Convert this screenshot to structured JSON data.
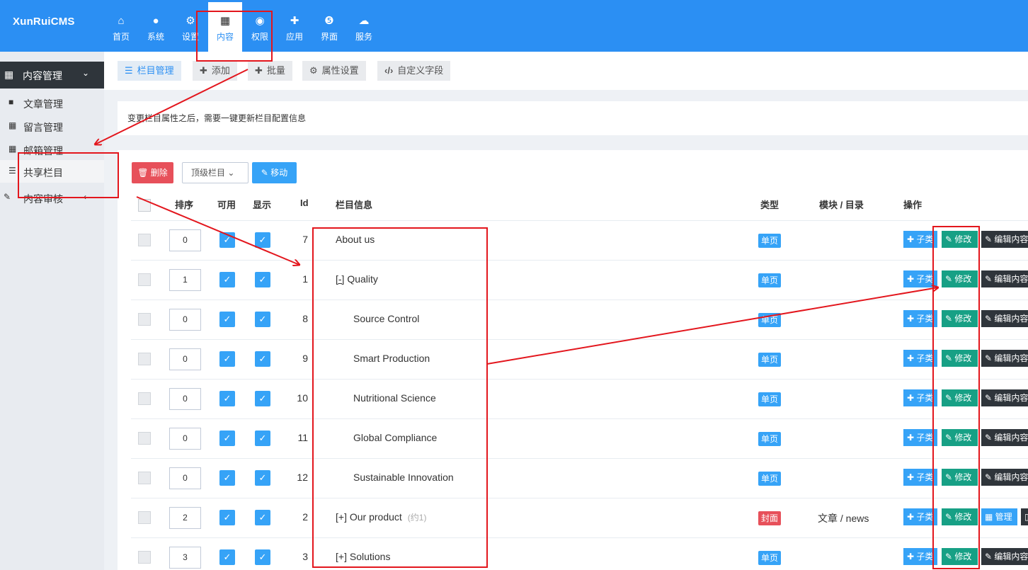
{
  "header": {
    "logo": "XunRuiCMS",
    "nav": [
      {
        "icon": "home-icon",
        "glyph": "⌂",
        "label": "首页"
      },
      {
        "icon": "globe-icon",
        "glyph": "●",
        "label": "系统"
      },
      {
        "icon": "gears-icon",
        "glyph": "⚙",
        "label": "设置"
      },
      {
        "icon": "grid-icon",
        "glyph": "▦",
        "label": "内容"
      },
      {
        "icon": "user-circle-icon",
        "glyph": "◉",
        "label": "权限"
      },
      {
        "icon": "puzzle-icon",
        "glyph": "✚",
        "label": "应用"
      },
      {
        "icon": "html5-icon",
        "glyph": "❺",
        "label": "界面"
      },
      {
        "icon": "cloud-icon",
        "glyph": "☁",
        "label": "服务"
      }
    ]
  },
  "sidebar": {
    "group": "内容管理",
    "items": [
      {
        "label": "文章管理"
      },
      {
        "label": "留言管理"
      },
      {
        "label": "邮箱管理"
      },
      {
        "label": "共享栏目"
      }
    ],
    "group2": "内容审核"
  },
  "toolbar": {
    "buttons": [
      {
        "label": "栏目管理"
      },
      {
        "label": "添加"
      },
      {
        "label": "批量"
      },
      {
        "label": "属性设置"
      },
      {
        "label": "自定义字段"
      }
    ]
  },
  "notice": "变更栏目属性之后，需要一键更新栏目配置信息",
  "actions": {
    "delete": "删除",
    "parent_select": "顶级栏目",
    "move": "移动"
  },
  "table": {
    "headers": {
      "sort": "排序",
      "enabled": "可用",
      "show": "显示",
      "id": "Id",
      "info": "栏目信息",
      "type": "类型",
      "module": "模块 / 目录",
      "ops": "操作"
    },
    "rows": [
      {
        "sort": "0",
        "id": "7",
        "name": "About us",
        "sub": "",
        "type": "单页",
        "module": ""
      },
      {
        "sort": "1",
        "id": "1",
        "name": "Quality",
        "prefix": "[-]",
        "sub": "",
        "type": "单页",
        "module": ""
      },
      {
        "sort": "0",
        "id": "8",
        "name": "Source Control",
        "sub": "",
        "type": "单页",
        "module": ""
      },
      {
        "sort": "0",
        "id": "9",
        "name": "Smart Production",
        "sub": "",
        "type": "单页",
        "module": ""
      },
      {
        "sort": "0",
        "id": "10",
        "name": "Nutritional Science",
        "sub": "",
        "type": "单页",
        "module": ""
      },
      {
        "sort": "0",
        "id": "11",
        "name": "Global Compliance",
        "sub": "",
        "type": "单页",
        "module": ""
      },
      {
        "sort": "0",
        "id": "12",
        "name": "Sustainable Innovation",
        "sub": "",
        "type": "单页",
        "module": ""
      },
      {
        "sort": "2",
        "id": "2",
        "name": "Our product",
        "prefix": "[+]",
        "sub": "(约1)",
        "type": "封面",
        "module": "文章 / news"
      },
      {
        "sort": "3",
        "id": "3",
        "name": "Solutions",
        "prefix": "[+]",
        "sub": "",
        "type": "单页",
        "module": ""
      }
    ],
    "op_labels": {
      "subtype": "子类",
      "edit": "修改",
      "edit_content": "编辑内容",
      "manage": "管理"
    }
  },
  "colors": {
    "primary": "#2b8ff3",
    "annotation": "#e3161d",
    "danger": "#e7505a",
    "info": "#36a3f7",
    "success": "#17a085",
    "dark": "#2f353b"
  }
}
